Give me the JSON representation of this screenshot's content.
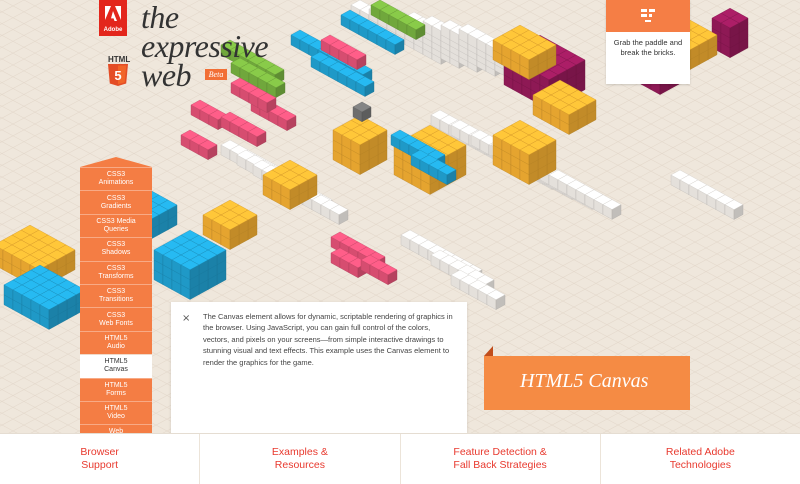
{
  "branding": {
    "adobe_label": "Adobe",
    "title_lines": [
      "the",
      "expressive",
      "web"
    ],
    "badge_label": "HTML",
    "beta_label": "Beta"
  },
  "game_hint": {
    "text": "Grab the paddle and break the bricks.",
    "icon": "brick-game-icon"
  },
  "sidenav": {
    "items": [
      {
        "label": "CSS3\nAnimations"
      },
      {
        "label": "CSS3\nGradients"
      },
      {
        "label": "CSS3 Media\nQueries"
      },
      {
        "label": "CSS3\nShadows"
      },
      {
        "label": "CSS3\nTransforms"
      },
      {
        "label": "CSS3\nTransitions"
      },
      {
        "label": "CSS3\nWeb Fonts"
      },
      {
        "label": "HTML5\nAudio"
      },
      {
        "label": "HTML5\nCanvas"
      },
      {
        "label": "HTML5\nForms"
      },
      {
        "label": "HTML5\nVideo"
      },
      {
        "label": "Web\nStorage"
      }
    ],
    "active_label": "HTML5\nCanvas"
  },
  "info_panel": {
    "close_glyph": "×",
    "text": "The Canvas element allows for dynamic, scriptable rendering of graphics in the browser. Using JavaScript, you can gain full control of the colors, vectors, and pixels on your screens—from simple interactive drawings to stunning visual and text effects. This example uses the Canvas element to render the graphics for the game."
  },
  "feature_tag": "HTML5 Canvas",
  "footer": {
    "links": [
      {
        "label": "Browser\nSupport"
      },
      {
        "label": "Examples &\nResources"
      },
      {
        "label": "Feature Detection &\nFall Back Strategies"
      },
      {
        "label": "Related Adobe\nTechnologies"
      }
    ]
  },
  "colors": {
    "background": "#efe7dc",
    "accent_orange": "#f47d44",
    "link_red": "#e8392e",
    "brick_yellow": "#f9b233",
    "brick_blue": "#22a6d8",
    "brick_purple": "#9a1b5c",
    "brick_pink": "#e9547a",
    "brick_green": "#7ab541",
    "brick_white": "#f8f4ee"
  }
}
